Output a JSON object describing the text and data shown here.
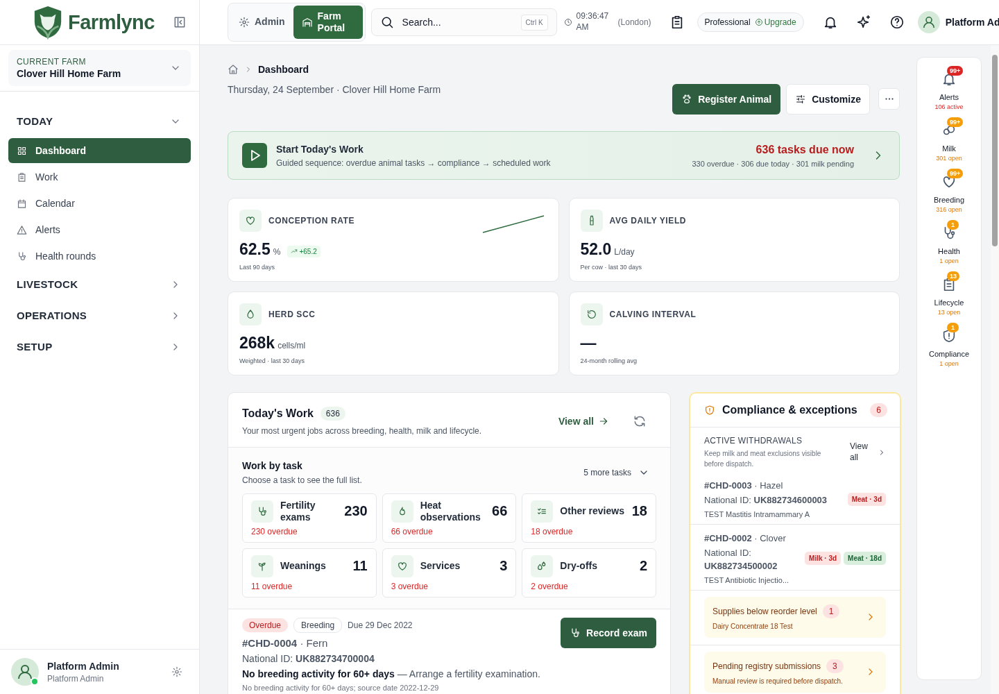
{
  "brand": {
    "name": "Farmlync"
  },
  "farm_selector": {
    "label": "CURRENT FARM",
    "value": "Clover Hill Home Farm"
  },
  "nav": [
    {
      "label": "TODAY",
      "expanded": true,
      "items": [
        {
          "label": "Dashboard",
          "selected": true
        },
        {
          "label": "Work",
          "selected": false
        },
        {
          "label": "Calendar",
          "selected": false
        },
        {
          "label": "Alerts",
          "selected": false
        },
        {
          "label": "Health rounds",
          "selected": false
        }
      ]
    },
    {
      "label": "LIVESTOCK",
      "expanded": false
    },
    {
      "label": "OPERATIONS",
      "expanded": false
    },
    {
      "label": "SETUP",
      "expanded": false
    }
  ],
  "sidebar_user": {
    "name": "Platform Admin",
    "role": "Platform Admin",
    "online": true
  },
  "portal_switch": [
    {
      "label": "Admin",
      "selected": false
    },
    {
      "label": "Farm Portal",
      "selected": true
    }
  ],
  "search": {
    "placeholder": "Search...",
    "shortcut": "Ctrl K"
  },
  "clock": {
    "time": "09:36:47 AM",
    "zone": "(London)"
  },
  "plan": {
    "name": "Professional",
    "action": "Upgrade"
  },
  "top_user": {
    "name": "Platform Ad"
  },
  "breadcrumb": [
    "Dashboard"
  ],
  "subtitle": "Thursday, 24 September · Clover Hill Home Farm",
  "actions": {
    "primary": "Register Animal",
    "secondary": "Customize"
  },
  "banner": {
    "title": "Start Today's Work",
    "subtitle": "Guided sequence: overdue animal tasks → compliance → scheduled work",
    "due": "636 tasks due now",
    "detail": "330 overdue · 306 due today · 301 milk pending"
  },
  "kpis": [
    {
      "label": "CONCEPTION RATE",
      "value": "62.5",
      "unit": "%",
      "delta": "+65.2",
      "caption": "Last 90 days"
    },
    {
      "label": "AVG DAILY YIELD",
      "value": "52.0",
      "unit": "L/day",
      "caption": "Per cow · last 30 days"
    },
    {
      "label": "HERD SCC",
      "value": "268k",
      "unit": "cells/ml",
      "caption": "Weighted · last 30 days"
    },
    {
      "label": "CALVING INTERVAL",
      "value": "—",
      "caption": "24-month rolling avg"
    }
  ],
  "todays_work": {
    "title": "Today's Work",
    "count": "636",
    "subtitle": "Your most urgent jobs across breeding, health, milk and lifecycle.",
    "view_all": "View all",
    "section": "Work by task",
    "hint": "Choose a task to see the full list.",
    "more": "5 more tasks",
    "tasks": [
      {
        "label": "Fertility exams",
        "count": "230",
        "overdue": "230 overdue"
      },
      {
        "label": "Heat observations",
        "count": "66",
        "overdue": "66 overdue"
      },
      {
        "label": "Other reviews",
        "count": "18",
        "overdue": "18 overdue"
      },
      {
        "label": "Weanings",
        "count": "11",
        "overdue": "11 overdue"
      },
      {
        "label": "Services",
        "count": "3",
        "overdue": "3 overdue"
      },
      {
        "label": "Dry-offs",
        "count": "2",
        "overdue": "2 overdue"
      }
    ],
    "item": {
      "badges": [
        {
          "label": "Overdue",
          "kind": "danger"
        },
        {
          "label": "Breeding",
          "kind": "neutral"
        }
      ],
      "due": "Due 29 Dec 2022",
      "animal": "**#CHD-0004** · Fern",
      "national_id": "National ID: **UK882734700004**",
      "reason": "**No breeding activity for 60+ days** — Arrange a fertility examination.",
      "note": "No breeding activity for 60+ days; source date 2022-12-29",
      "button": "Record exam"
    }
  },
  "compliance": {
    "title": "Compliance & exceptions",
    "count": "6",
    "heading": "ACTIVE WITHDRAWALS",
    "description": "Keep milk and meat exclusions visible before dispatch.",
    "view_all": "View all",
    "withdrawals": [
      {
        "animal": "**#CHD-0003** · Hazel",
        "national_id": "National ID: **UK882734600003**",
        "treatment": "TEST Mastitis Intramammary A",
        "flags": [
          {
            "label": "Meat · 3d",
            "kind": "urgent"
          }
        ]
      },
      {
        "animal": "**#CHD-0002** · Clover",
        "national_id": "National ID: **UK882734500002**",
        "treatment": "TEST Antibiotic Injectio...",
        "flags": [
          {
            "label": "Milk · 3d",
            "kind": "urgent"
          },
          {
            "label": "Meat · 18d",
            "kind": "ok"
          }
        ]
      }
    ],
    "exceptions": [
      {
        "title": "Supplies below reorder level",
        "count": "1",
        "detail": "Dairy Concentrate 18 Test"
      },
      {
        "title": "Pending registry submissions",
        "count": "3",
        "detail": "Manual review is required before dispatch."
      }
    ]
  },
  "rail": [
    {
      "label": "Alerts",
      "badge": "99+",
      "status": "106 active",
      "kind": "critical"
    },
    {
      "label": "Milk",
      "badge": "99+",
      "status": "301 open",
      "kind": "warning"
    },
    {
      "label": "Breeding",
      "badge": "99+",
      "status": "316 open",
      "kind": "warning"
    },
    {
      "label": "Health",
      "badge": "1",
      "status": "1 open",
      "kind": "warning"
    },
    {
      "label": "Lifecycle",
      "badge": "13",
      "status": "13 open",
      "kind": "warning"
    },
    {
      "label": "Compliance",
      "badge": "1",
      "status": "1 open",
      "kind": "warning"
    }
  ]
}
